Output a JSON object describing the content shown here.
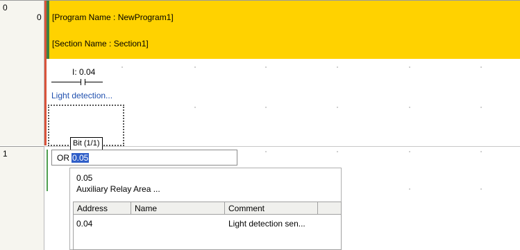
{
  "rungs": [
    {
      "number": "0",
      "step": "0"
    },
    {
      "number": "1"
    }
  ],
  "header": {
    "program_name": "[Program Name : NewProgram1]",
    "section_name": "[Section Name : Section1]"
  },
  "contact": {
    "address": "I: 0.04",
    "comment": "Light detection..."
  },
  "tooltip": "Bit (1/1)",
  "editor": {
    "operator": "OR",
    "value": "0.05"
  },
  "suggestion": {
    "value": "0.05",
    "description": "Auxiliary Relay Area ..."
  },
  "list": {
    "columns": [
      "Address",
      "Name",
      "Comment"
    ],
    "rows": [
      {
        "address": "0.04",
        "name": "",
        "comment": "Light detection sen..."
      }
    ]
  },
  "colors": {
    "header_bg": "#ffd200",
    "left_rail": "#d9533a",
    "power_rail": "#3f7f3f",
    "comment_text": "#1f4fae",
    "selection": "#2f5ec8"
  }
}
